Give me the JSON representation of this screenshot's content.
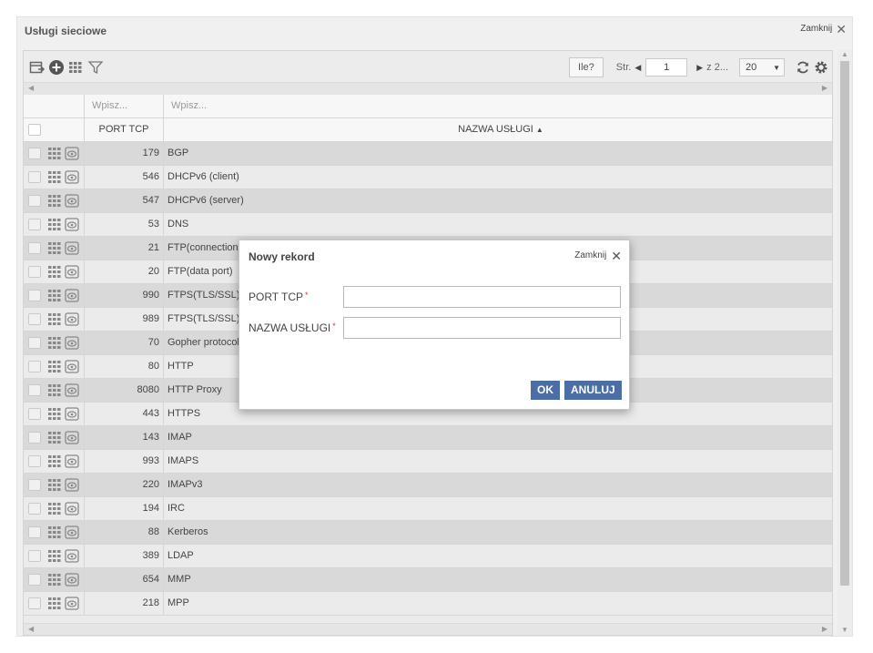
{
  "window": {
    "title": "Usługi sieciowe",
    "close_label": "Zamknij"
  },
  "toolbar": {
    "icons": [
      "export-icon",
      "add-icon",
      "columns-grid-icon",
      "filter-icon"
    ],
    "count_button": "Ile?",
    "page_label": "Str.",
    "page_value": "1",
    "page_total": "z 2...",
    "page_size": "20",
    "refresh_icon": "refresh-icon",
    "settings_icon": "gear-icon"
  },
  "filters": {
    "port_placeholder": "Wpisz...",
    "name_placeholder": "Wpisz..."
  },
  "columns": {
    "port": "PORT TCP",
    "name": "NAZWA USŁUGI",
    "sort_indicator": "▲"
  },
  "rows": [
    {
      "port": "179",
      "name": "BGP"
    },
    {
      "port": "546",
      "name": "DHCPv6 (client)"
    },
    {
      "port": "547",
      "name": "DHCPv6 (server)"
    },
    {
      "port": "53",
      "name": "DNS"
    },
    {
      "port": "21",
      "name": "FTP(connection"
    },
    {
      "port": "20",
      "name": "FTP(data port)"
    },
    {
      "port": "990",
      "name": "FTPS(TLS/SSL)"
    },
    {
      "port": "989",
      "name": "FTPS(TLS/SSL)"
    },
    {
      "port": "70",
      "name": "Gopher protocol"
    },
    {
      "port": "80",
      "name": "HTTP"
    },
    {
      "port": "8080",
      "name": "HTTP Proxy"
    },
    {
      "port": "443",
      "name": "HTTPS"
    },
    {
      "port": "143",
      "name": "IMAP"
    },
    {
      "port": "993",
      "name": "IMAPS"
    },
    {
      "port": "220",
      "name": "IMAPv3"
    },
    {
      "port": "194",
      "name": "IRC"
    },
    {
      "port": "88",
      "name": "Kerberos"
    },
    {
      "port": "389",
      "name": "LDAP"
    },
    {
      "port": "654",
      "name": "MMP"
    },
    {
      "port": "218",
      "name": "MPP"
    }
  ],
  "dialog": {
    "title": "Nowy rekord",
    "close_label": "Zamknij",
    "port_label": "PORT TCP",
    "name_label": "NAZWA USŁUGI",
    "required_mark": "*",
    "port_value": "",
    "name_value": "",
    "ok_label": "OK",
    "cancel_label": "ANULUJ"
  },
  "colors": {
    "primary_button": "#4b6ea6",
    "row_even": "#d9d9d9",
    "row_odd": "#ebebeb",
    "required": "#dd3333"
  }
}
